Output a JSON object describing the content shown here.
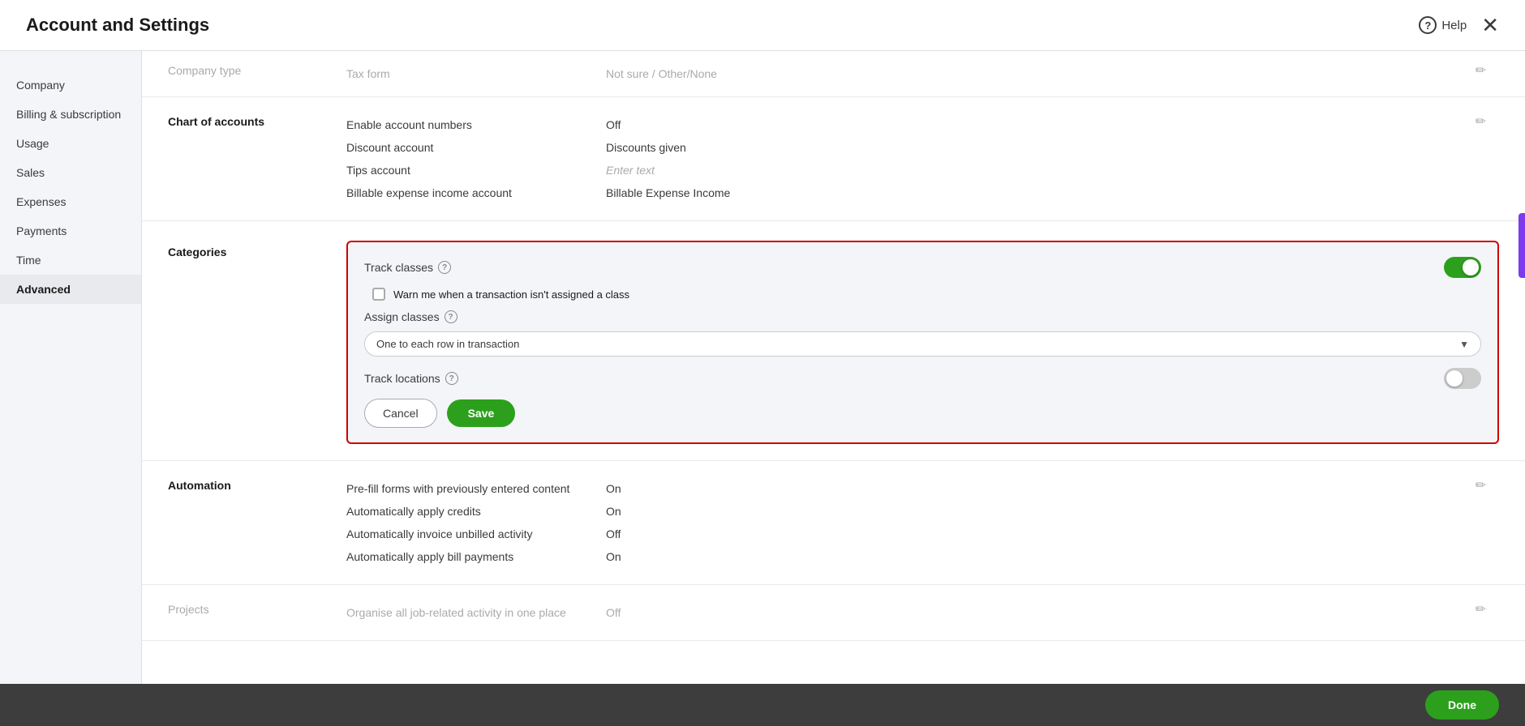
{
  "header": {
    "title": "Account and Settings",
    "help_label": "Help",
    "close_label": "×"
  },
  "sidebar": {
    "items": [
      {
        "id": "company",
        "label": "Company"
      },
      {
        "id": "billing",
        "label": "Billing & subscription"
      },
      {
        "id": "usage",
        "label": "Usage"
      },
      {
        "id": "sales",
        "label": "Sales"
      },
      {
        "id": "expenses",
        "label": "Expenses"
      },
      {
        "id": "payments",
        "label": "Payments"
      },
      {
        "id": "time",
        "label": "Time"
      },
      {
        "id": "advanced",
        "label": "Advanced",
        "active": true
      }
    ]
  },
  "content": {
    "truncated_row": {
      "label": "Company type",
      "value": "Tax form",
      "value2": "Not sure / Other/None"
    },
    "chart_of_accounts": {
      "section_label": "Chart of accounts",
      "rows": [
        {
          "label": "Enable account numbers",
          "value": "Off"
        },
        {
          "label": "Discount account",
          "value": "Discounts given"
        },
        {
          "label": "Tips account",
          "value": "",
          "placeholder": "Enter text"
        },
        {
          "label": "Billable expense income account",
          "value": "Billable Expense Income"
        }
      ]
    },
    "categories": {
      "section_label": "Categories",
      "track_classes_label": "Track classes",
      "track_classes_on": true,
      "warn_checkbox_label": "Warn me when a transaction isn't assigned a class",
      "warn_checked": false,
      "assign_classes_label": "Assign classes",
      "assign_dropdown_value": "One to each row in transaction",
      "track_locations_label": "Track locations",
      "track_locations_on": false,
      "cancel_label": "Cancel",
      "save_label": "Save"
    },
    "automation": {
      "section_label": "Automation",
      "rows": [
        {
          "label": "Pre-fill forms with previously entered content",
          "value": "On"
        },
        {
          "label": "Automatically apply credits",
          "value": "On"
        },
        {
          "label": "Automatically invoice unbilled activity",
          "value": "Off"
        },
        {
          "label": "Automatically apply bill payments",
          "value": "On"
        }
      ]
    },
    "projects": {
      "section_label": "Projects",
      "rows": [
        {
          "label": "Organise all job-related activity in one place",
          "value": "Off"
        }
      ]
    }
  },
  "bottom_bar": {
    "done_label": "Done"
  }
}
